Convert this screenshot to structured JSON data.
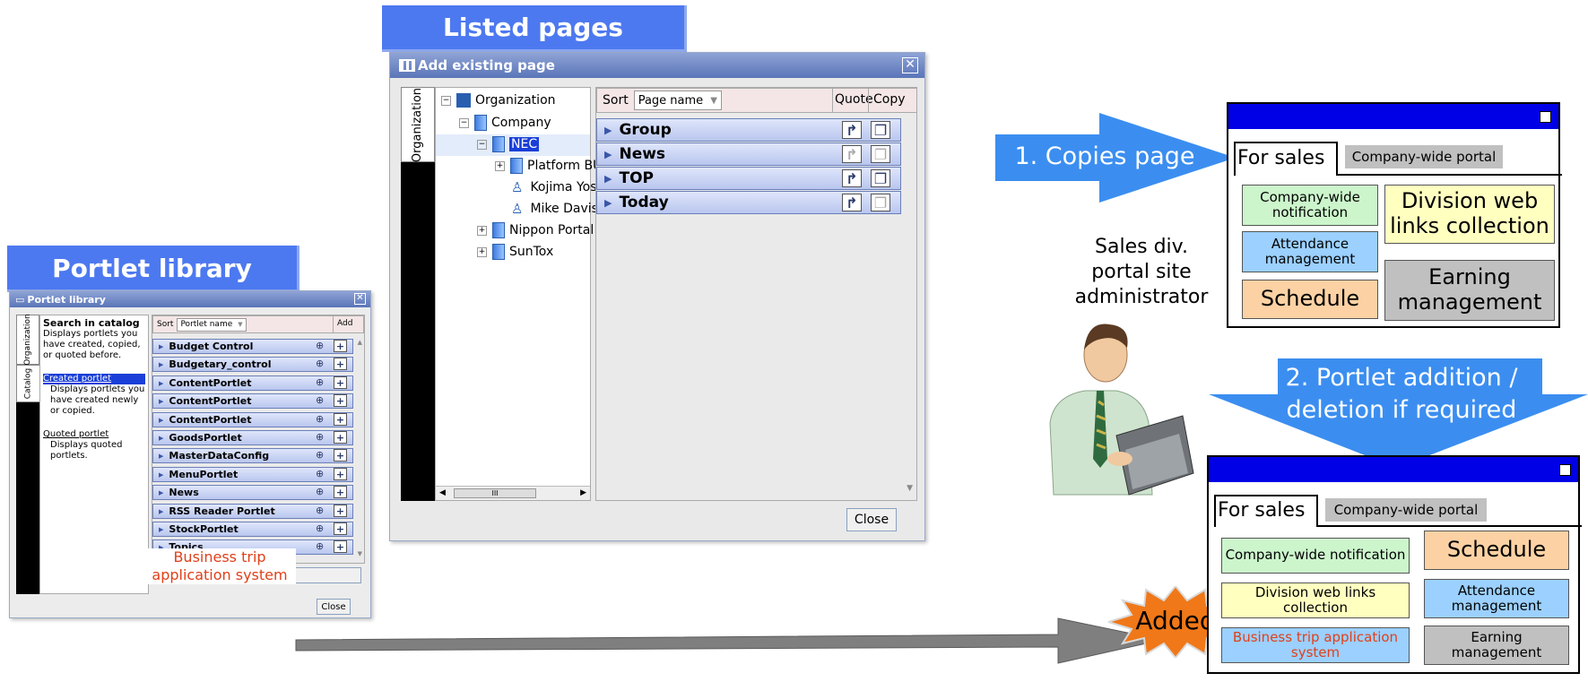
{
  "banners": {
    "listed_pages": "Listed pages",
    "portlet_library": "Portlet library"
  },
  "add_page_window": {
    "title": "Add existing page",
    "vtab": "Organization",
    "tree": [
      "Organization",
      "Company",
      "NEC",
      "Platform BU",
      "Kojima Yos",
      "Mike Davis",
      "Nippon Portal C",
      "SunTox"
    ],
    "sort_label": "Sort",
    "sort_value": "Page name",
    "col_quote": "Quote",
    "col_copy": "Copy",
    "pages": [
      "Group",
      "News",
      "TOP",
      "Today"
    ],
    "scroll_label": "III",
    "close": "Close"
  },
  "portlet_window": {
    "title": "Portlet library",
    "vtab_org": "Organization",
    "vtab_catalog": "Catalog",
    "search_heading": "Search in catalog",
    "search_desc": "Displays portlets you have created, copied, or quoted before.",
    "created_link": "Created portlet",
    "created_desc": "Displays portlets you have created newly or copied.",
    "quoted_link": "Quoted portlet",
    "quoted_desc": "Displays quoted portlets.",
    "sort_label": "Sort",
    "sort_value": "Portlet name",
    "add_label": "Add",
    "portlets": [
      "Budget Control",
      "Budgetary_control",
      "ContentPortlet",
      "ContentPortlet",
      "ContentPortlet",
      "GoodsPortlet",
      "MasterDataConfig",
      "MenuPortlet",
      "News",
      "RSS Reader Portlet",
      "StockPortlet",
      "Topics"
    ],
    "close": "Close",
    "partial_button": "C"
  },
  "business_trip_label": "Business trip application system",
  "step1": "1. Copies page",
  "step2": "2. Portlet addition / deletion if required",
  "admin_label": "Sales div. portal site administrator",
  "added": "Added",
  "mockup_top": {
    "tab_active": "For sales",
    "tab_other": "Company-wide portal",
    "boxes": [
      "Company-wide notification",
      "Division web links collection",
      "Attendance management",
      "Schedule",
      "Earning management"
    ]
  },
  "mockup_bottom": {
    "tab_active": "For sales",
    "tab_other": "Company-wide portal",
    "boxes": [
      "Company-wide notification",
      "Schedule",
      "Division web links collection",
      "Attendance management",
      "Business trip application system",
      "Earning management"
    ]
  },
  "colors": {
    "banner": "#4d79f0",
    "arrow": "#3b8ef0",
    "green": "#ccf5cc",
    "blue": "#9bd0ff",
    "orange": "#fcd2a4",
    "yellow": "#ffffc0",
    "gray": "#c0c0c0",
    "red_text": "#e0401a",
    "burst": "#f07818"
  }
}
